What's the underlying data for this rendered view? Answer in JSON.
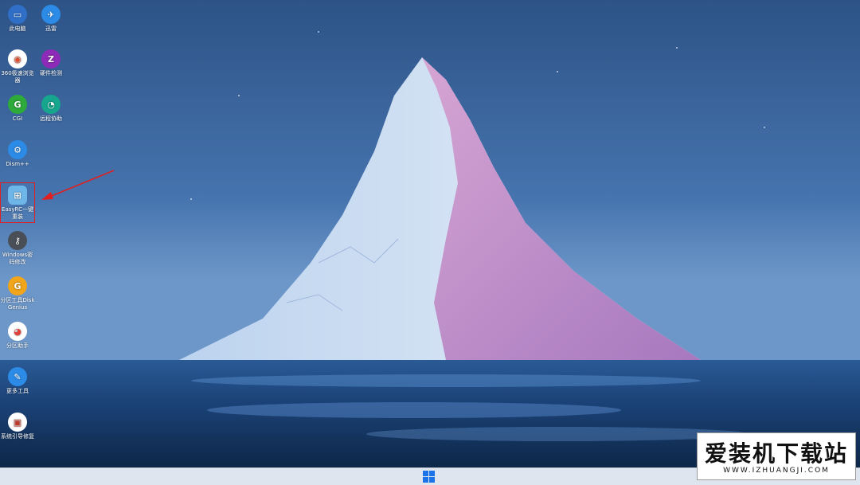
{
  "desktop_icons": [
    {
      "label": "此电脑",
      "icon": "computer-icon",
      "color": "#2f6fc8",
      "glyph": "▭"
    },
    {
      "label": "迅雷",
      "icon": "thunder-bird-icon",
      "color": "#2b8be6",
      "glyph": "✈"
    },
    {
      "label": "360极速浏览器",
      "icon": "browser-360-icon",
      "color": "#ffffff",
      "glyph": "◉"
    },
    {
      "label": "硬件检测",
      "icon": "hardware-check-icon",
      "color": "#8e2ab8",
      "glyph": "Z"
    },
    {
      "label": "CGI",
      "icon": "cgi-icon",
      "color": "#2eaa3a",
      "glyph": "G"
    },
    {
      "label": "远程协助",
      "icon": "remote-assist-icon",
      "color": "#16a68e",
      "glyph": "◔"
    },
    {
      "label": "Dism++",
      "icon": "dism-icon",
      "color": "#2b8be6",
      "glyph": "⚙"
    },
    {
      "label": "EasyRC一键重装",
      "icon": "easyrc-windows-icon",
      "color": "#6fb6e8",
      "glyph": "⊞"
    },
    {
      "label": "Windows密码修改",
      "icon": "key-icon",
      "color": "#4a4f57",
      "glyph": "⚷"
    },
    {
      "label": "分区工具DiskGenius",
      "icon": "diskgenius-icon",
      "color": "#f0a51a",
      "glyph": "G"
    },
    {
      "label": "分区助手",
      "icon": "partition-assistant-icon",
      "color": "#ffffff",
      "glyph": "◕"
    },
    {
      "label": "更多工具",
      "icon": "wrench-icon",
      "color": "#2b8be6",
      "glyph": "✎"
    },
    {
      "label": "系统引导修复",
      "icon": "toolbox-icon",
      "color": "#ffffff",
      "glyph": "▣"
    }
  ],
  "taskbar": {
    "start_icon": "windows-start-icon"
  },
  "watermark": {
    "title": "爱装机下载站",
    "url": "WWW.IZHUANGJI.COM"
  },
  "colors": {
    "highlight": "#e02020",
    "taskbar_bg": "#dfe5ee"
  }
}
